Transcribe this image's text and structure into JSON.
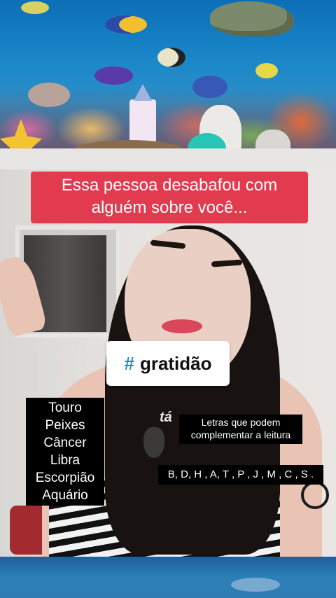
{
  "headline": {
    "line1": "Essa pessoa desabafou com",
    "line2": "alguém sobre você..."
  },
  "hashtag": {
    "symbol": "#",
    "word": "gratidão"
  },
  "signs": [
    "Touro",
    "Peixes",
    "Câncer",
    "Libra",
    "Escorpião",
    "Aquário"
  ],
  "caption_word": "tá",
  "letters_note": {
    "line1": "Letras que podem",
    "line2": "complementar a leitura"
  },
  "letters": "B, D, H , A, T , P , J , M , C , S .",
  "colors": {
    "headline_bg": "#e23a4e",
    "hashtag_symbol": "#1e88e5",
    "label_bg": "#000000"
  }
}
